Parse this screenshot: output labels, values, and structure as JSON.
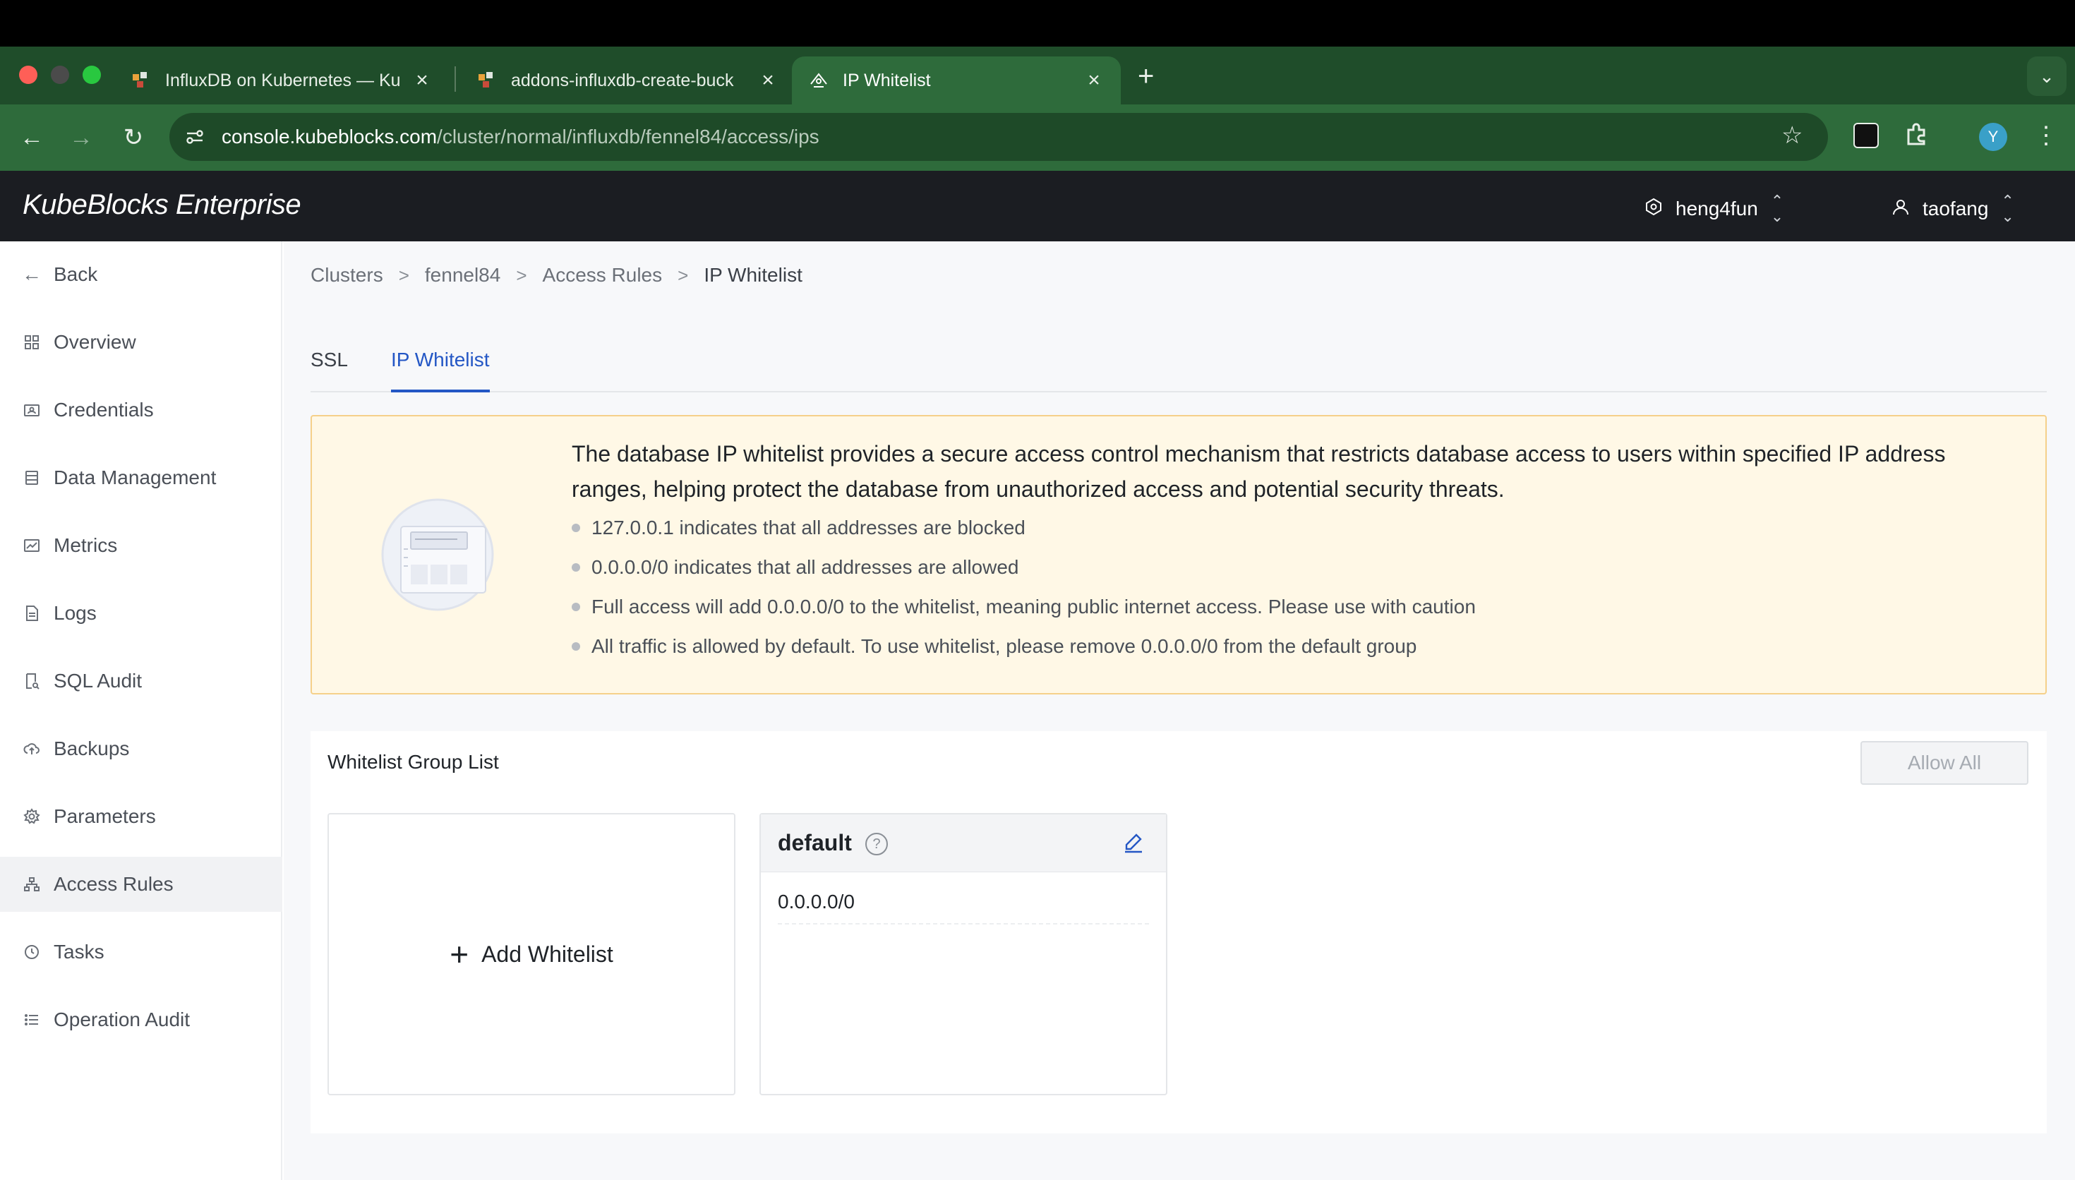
{
  "browser": {
    "tabs": [
      {
        "title": "InfluxDB on Kubernetes — Ku",
        "active": false,
        "favicon": "kubeblocks-icon"
      },
      {
        "title": "addons-influxdb-create-buck",
        "active": false,
        "favicon": "kubeblocks-icon"
      },
      {
        "title": "IP Whitelist",
        "active": true,
        "favicon": "kubeblocks-enterprise-icon"
      }
    ],
    "url_host": "console.kubeblocks.com",
    "url_path": "/cluster/normal/influxdb/fennel84/access/ips",
    "profile_initial": "Y"
  },
  "header": {
    "brand": "KubeBlocks Enterprise",
    "org": "heng4fun",
    "user": "taofang"
  },
  "sidebar": {
    "items": [
      {
        "label": "Back",
        "icon": "arrow-left-icon"
      },
      {
        "label": "Overview",
        "icon": "grid-icon"
      },
      {
        "label": "Credentials",
        "icon": "credential-icon"
      },
      {
        "label": "Data Management",
        "icon": "database-icon"
      },
      {
        "label": "Metrics",
        "icon": "chart-icon"
      },
      {
        "label": "Logs",
        "icon": "document-icon"
      },
      {
        "label": "SQL Audit",
        "icon": "audit-icon"
      },
      {
        "label": "Backups",
        "icon": "cloud-upload-icon"
      },
      {
        "label": "Parameters",
        "icon": "gear-icon"
      },
      {
        "label": "Access Rules",
        "icon": "network-icon"
      },
      {
        "label": "Tasks",
        "icon": "clock-icon"
      },
      {
        "label": "Operation Audit",
        "icon": "list-icon"
      }
    ],
    "active": "Access Rules"
  },
  "breadcrumb": [
    "Clusters",
    "fennel84",
    "Access Rules",
    "IP Whitelist"
  ],
  "page_tabs": [
    {
      "label": "SSL",
      "active": false
    },
    {
      "label": "IP Whitelist",
      "active": true
    }
  ],
  "notice": {
    "headline": "The database IP whitelist provides a secure access control mechanism that restricts database access to users within specified IP address ranges, helping protect the database from unauthorized access and potential security threats.",
    "bullets": [
      "127.0.0.1 indicates that all addresses are blocked",
      "0.0.0.0/0 indicates that all addresses are allowed",
      "Full access will add 0.0.0.0/0 to the whitelist, meaning public internet access. Please use with caution",
      "All traffic is allowed by default. To use whitelist, please remove 0.0.0.0/0 from the default group"
    ]
  },
  "whitelist": {
    "title": "Whitelist Group List",
    "allow_all_label": "Allow All",
    "allow_all_disabled": true,
    "add_label": "Add Whitelist",
    "groups": [
      {
        "name": "default",
        "ips": [
          "0.0.0.0/0"
        ]
      }
    ]
  },
  "colors": {
    "accent": "#2457c5",
    "tabbar": "#1f4d2a",
    "header": "#1b1d22",
    "notice_bg": "#fff8e6",
    "notice_border": "#f5d08a"
  }
}
